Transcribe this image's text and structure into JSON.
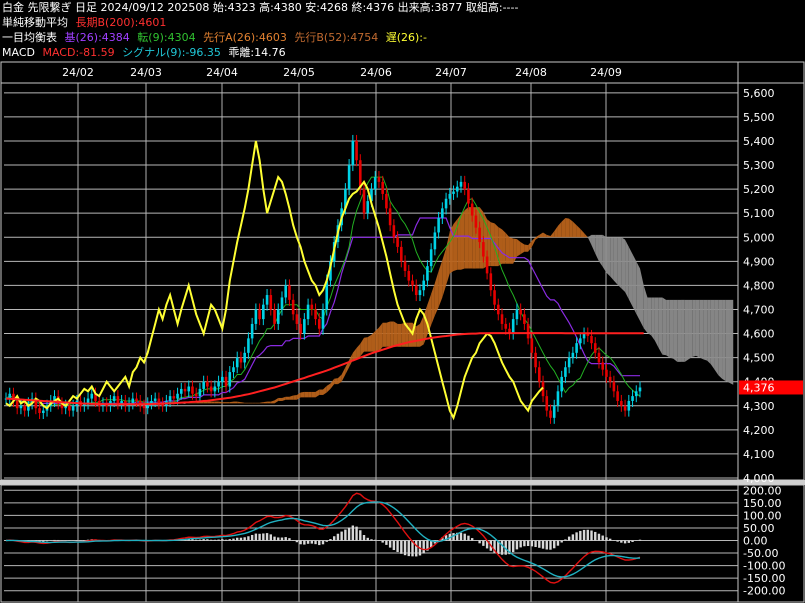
{
  "header": {
    "line1": "白金 先限繋ぎ 日足 2024/09/12 202508 始:4323 高:4380 安:4268 終:4376 出来高:3877 取組高:----",
    "sma_label": "単純移動平均",
    "sma_value": "長期B(200):4601",
    "ichimoku_label": "一目均衡表",
    "ichimoku_kijun": "基(26):4384",
    "ichimoku_tenkan": "転(9):4304",
    "ichimoku_spanA": "先行A(26):4603",
    "ichimoku_spanB": "先行B(52):4754",
    "ichimoku_chikou": "遅(26):-",
    "macd_label": "MACD",
    "macd_value": "MACD:-81.59",
    "macd_signal": "シグナル(9):-96.35",
    "macd_hist": "乖離:14.76"
  },
  "colors": {
    "up": "#00d2e6",
    "down": "#e60000",
    "sma200": "#ff2020",
    "kijun": "#8a2be2",
    "tenkan": "#22b022",
    "chikou": "#ffff33",
    "cloud_bull": "#b8621a",
    "cloud_bear": "#8c8c8c",
    "price_tag": "#ff0000"
  },
  "chart_data": [
    {
      "type": "candlestick",
      "title": "白金 先限繋ぎ 日足",
      "x_ticks": [
        "24/02",
        "24/03",
        "24/04",
        "24/05",
        "24/06",
        "24/07",
        "24/08",
        "24/09"
      ],
      "y_ticks": [
        "4,000",
        "4,100",
        "4,200",
        "4,300",
        "4,400",
        "4,500",
        "4,600",
        "4,700",
        "4,800",
        "4,900",
        "5,000",
        "5,100",
        "5,200",
        "5,300",
        "5,400",
        "5,500",
        "5,600"
      ],
      "ylim": [
        4000,
        5620
      ],
      "last_price_label": "4,376",
      "last_price": 4376,
      "grid": true,
      "series": {
        "close": [
          4330,
          4350,
          4320,
          4290,
          4300,
          4280,
          4310,
          4330,
          4290,
          4270,
          4280,
          4300,
          4320,
          4340,
          4310,
          4290,
          4300,
          4280,
          4300,
          4320,
          4300,
          4310,
          4330,
          4350,
          4320,
          4300,
          4310,
          4300,
          4320,
          4340,
          4310,
          4320,
          4300,
          4310,
          4330,
          4320,
          4300,
          4290,
          4310,
          4320,
          4330,
          4310,
          4300,
          4320,
          4340,
          4330,
          4350,
          4370,
          4360,
          4380,
          4350,
          4340,
          4370,
          4400,
          4380,
          4360,
          4380,
          4400,
          4420,
          4380,
          4440,
          4460,
          4500,
          4480,
          4520,
          4580,
          4640,
          4700,
          4660,
          4720,
          4760,
          4700,
          4640,
          4700,
          4750,
          4800,
          4740,
          4680,
          4640,
          4600,
          4660,
          4720,
          4700,
          4660,
          4620,
          4700,
          4820,
          4900,
          4980,
          5050,
          5120,
          5200,
          5300,
          5400,
          5320,
          5200,
          5100,
          5150,
          5200,
          5250,
          5230,
          5180,
          5120,
          5050,
          5000,
          4960,
          4900,
          4860,
          4820,
          4800,
          4760,
          4780,
          4820,
          4880,
          4950,
          5020,
          5080,
          5120,
          5160,
          5180,
          5190,
          5210,
          5230,
          5200,
          5140,
          5090,
          5040,
          4980,
          4920,
          4850,
          4780,
          4720,
          4680,
          4640,
          4620,
          4600,
          4660,
          4700,
          4680,
          4640,
          4580,
          4520,
          4460,
          4400,
          4340,
          4280,
          4250,
          4300,
          4360,
          4420,
          4460,
          4500,
          4520,
          4560,
          4580,
          4600,
          4590,
          4560,
          4520,
          4480,
          4450,
          4420,
          4400,
          4360,
          4320,
          4300,
          4280,
          4320,
          4340,
          4360,
          4376
        ],
        "sma200": [
          4330,
          4329,
          4328,
          4327,
          4326,
          4325,
          4324,
          4323,
          4322,
          4321,
          4320,
          4319,
          4318,
          4317,
          4316,
          4315,
          4314,
          4313,
          4312,
          4311,
          4310,
          4309,
          4309,
          4308,
          4308,
          4307,
          4307,
          4307,
          4306,
          4306,
          4306,
          4306,
          4306,
          4306,
          4306,
          4306,
          4306,
          4307,
          4307,
          4307,
          4308,
          4308,
          4309,
          4310,
          4310,
          4311,
          4312,
          4313,
          4314,
          4315,
          4316,
          4317,
          4318,
          4320,
          4321,
          4323,
          4325,
          4327,
          4329,
          4331,
          4333,
          4336,
          4339,
          4342,
          4345,
          4348,
          4352,
          4356,
          4360,
          4364,
          4368,
          4372,
          4376,
          4381,
          4386,
          4391,
          4396,
          4401,
          4406,
          4411,
          4416,
          4421,
          4426,
          4431,
          4436,
          4441,
          4446,
          4452,
          4458,
          4464,
          4470,
          4476,
          4482,
          4488,
          4494,
          4500,
          4506,
          4512,
          4518,
          4523,
          4528,
          4533,
          4538,
          4543,
          4548,
          4552,
          4556,
          4560,
          4564,
          4567,
          4570,
          4573,
          4576,
          4579,
          4582,
          4584,
          4586,
          4588,
          4590,
          4592,
          4594,
          4596,
          4597,
          4598,
          4599,
          4600,
          4600,
          4601,
          4601,
          4601,
          4602,
          4602,
          4602,
          4602,
          4602,
          4602,
          4602,
          4602,
          4602,
          4602,
          4602,
          4602,
          4602,
          4602,
          4602,
          4602,
          4602,
          4602,
          4602,
          4602,
          4601,
          4601,
          4601,
          4601,
          4601,
          4601,
          4601,
          4601,
          4601,
          4601,
          4601,
          4601,
          4601,
          4601,
          4601,
          4601,
          4601,
          4601,
          4601,
          4601,
          4601,
          4601
        ]
      }
    },
    {
      "type": "line",
      "title": "MACD",
      "y_ticks": [
        "200.00",
        "150.00",
        "100.00",
        "50.00",
        "0.00",
        "-50.00",
        "-100.00",
        "-150.00",
        "-200.00"
      ],
      "ylim": [
        -205,
        205
      ],
      "series": [
        {
          "name": "MACD",
          "last": -81.59
        },
        {
          "name": "シグナル(9)",
          "last": -96.35
        },
        {
          "name": "乖離",
          "last": 14.76
        }
      ]
    }
  ]
}
